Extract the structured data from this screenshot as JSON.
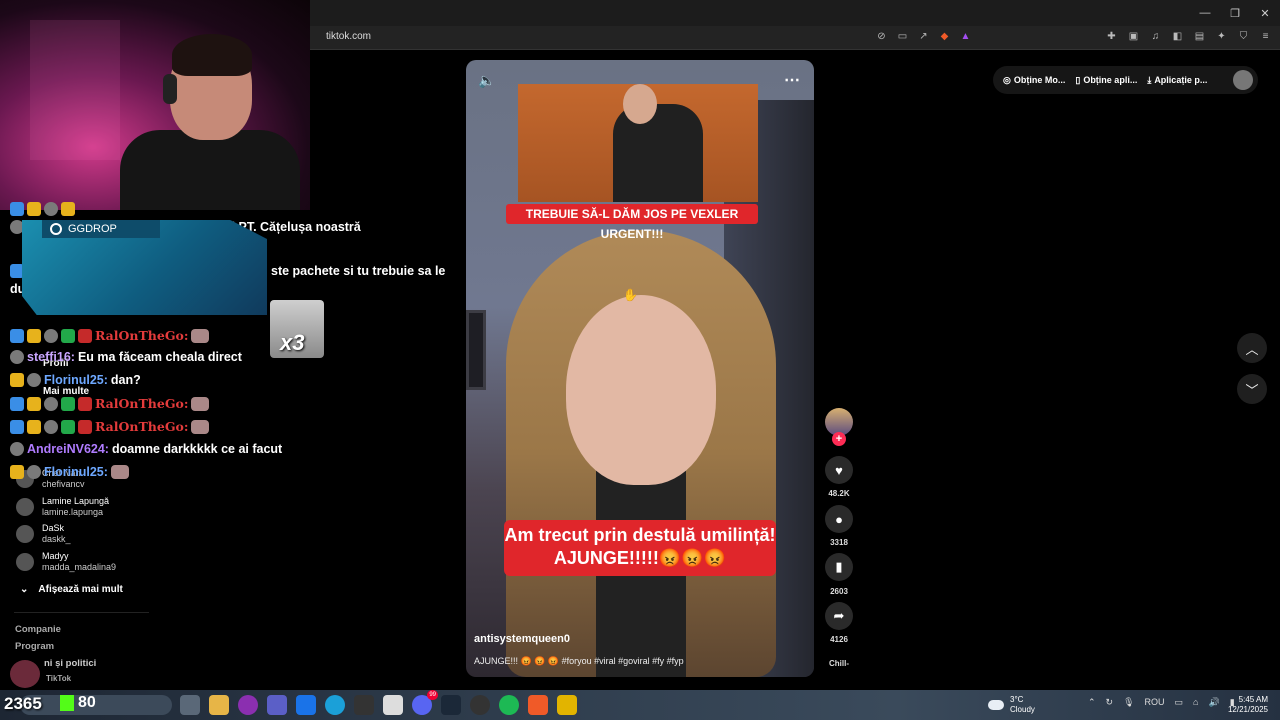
{
  "browser": {
    "url": "tiktok.com",
    "window_controls": [
      "—",
      "❐",
      "✕"
    ]
  },
  "chat": {
    "promo_label": "GGDROP",
    "emote_multiplier": "x3",
    "lines": [
      {
        "user": "",
        "text": "wole de bani PT. Cățelușa noastră"
      },
      {
        "user": "",
        "text": "ste pachete si tu trebuie sa le"
      },
      {
        "user": "",
        "text": "du"
      },
      {
        "user": "RalOnTheGo:",
        "text": ""
      },
      {
        "user": "steffi16:",
        "text": "Eu ma făceam cheala direct"
      },
      {
        "user": "Florinul25:",
        "text": "dan?"
      },
      {
        "user": "RalOnTheGo:",
        "text": ""
      },
      {
        "user": "RalOnTheGo:",
        "text": ""
      },
      {
        "user": "AndreiNV624:",
        "text": "doamne darkkkkk ce ai facut"
      },
      {
        "user": "Florinul25:",
        "text": ""
      }
    ]
  },
  "sidebar": {
    "profile_label": "Profil",
    "more_label": "Mai multe",
    "accounts": [
      {
        "name": "Chef Ivan",
        "handle": "chefivancv"
      },
      {
        "name": "Lamine Lapungă",
        "handle": "lamine.lapunga"
      },
      {
        "name": "DaSk",
        "handle": "daskk_"
      },
      {
        "name": "Madyy",
        "handle": "madda_madalina9"
      }
    ],
    "show_more": "Afișează mai mult",
    "links": [
      "Companie",
      "Program"
    ],
    "partial_link": "ni și politici",
    "footer": "TikTok"
  },
  "video": {
    "caption_top": "TREBUIE SĂ-L DĂM JOS PE VEXLER URGENT!!!",
    "caption_main_line1": "Am trecut prin destulă umilință!",
    "caption_main_line2": "AJUNGE!!!!!😡😡😡",
    "author": "antisystemqueen0",
    "description": "AJUNGE!!! 😡 😡 😡 #foryou #viral #goviral #fy #fyp"
  },
  "actions": {
    "likes": "48.2K",
    "comments": "3318",
    "saves": "2603",
    "shares": "4126",
    "music": "Chill-"
  },
  "top_actions": {
    "obtain_mo": "Obține Mo...",
    "obtain_app": "Obține apli...",
    "app_p": "Aplicație p..."
  },
  "overlay": {
    "viewer_count": "2365",
    "kick_count": "80"
  },
  "taskbar": {
    "weather_temp": "3°C",
    "weather_desc": "Cloudy",
    "lang": "ROU",
    "time": "5:45 AM",
    "date": "12/21/2025",
    "notification_badge": "99"
  },
  "colors": {
    "tiktok_red": "#fe2c55",
    "caption_red": "#e0262b",
    "kick_green": "#53fc18",
    "chat_red_user": "#e33b3b"
  }
}
